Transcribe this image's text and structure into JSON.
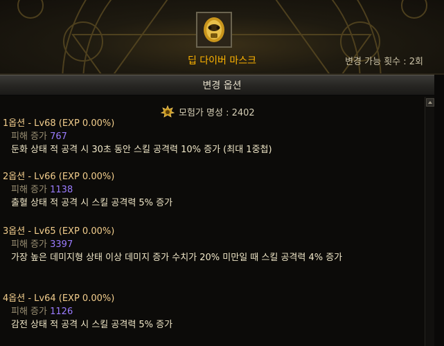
{
  "item": {
    "name": "딥 다이버 마스크",
    "icon": "diving-mask-icon",
    "change_count": "변경 가능 횟수 : 2회"
  },
  "section_title": "변경 옵션",
  "reputation": {
    "icon": "adventurer-reputation-icon",
    "text": "모험가 명성 : 2402"
  },
  "options": [
    {
      "title": "1옵션 - Lv68 (EXP 0.00%)",
      "damage_label": "피해 증가",
      "damage_value": "767",
      "desc": "둔화 상태 적 공격 시 30초 동안 스킬 공격력 10% 증가 (최대 1중첩)"
    },
    {
      "title": "2옵션 - Lv66 (EXP 0.00%)",
      "damage_label": "피해 증가",
      "damage_value": "1138",
      "desc": "출혈 상태 적 공격 시 스킬 공격력 5% 증가"
    },
    {
      "title": "3옵션 - Lv65 (EXP 0.00%)",
      "damage_label": "피해 증가",
      "damage_value": "3397",
      "desc": "가장 높은 데미지형 상태 이상 데미지 증가 수치가 20% 미만일 때 스킬 공격력 4% 증가"
    },
    {
      "title": "4옵션 - Lv64 (EXP 0.00%)",
      "damage_label": "피해 증가",
      "damage_value": "1126",
      "desc": "감전 상태 적 공격 시 스킬 공격력 5% 증가"
    }
  ],
  "colors": {
    "item_name": "#ffb400",
    "option_title": "#f3ce8d",
    "damage_value": "#9b7cff"
  }
}
